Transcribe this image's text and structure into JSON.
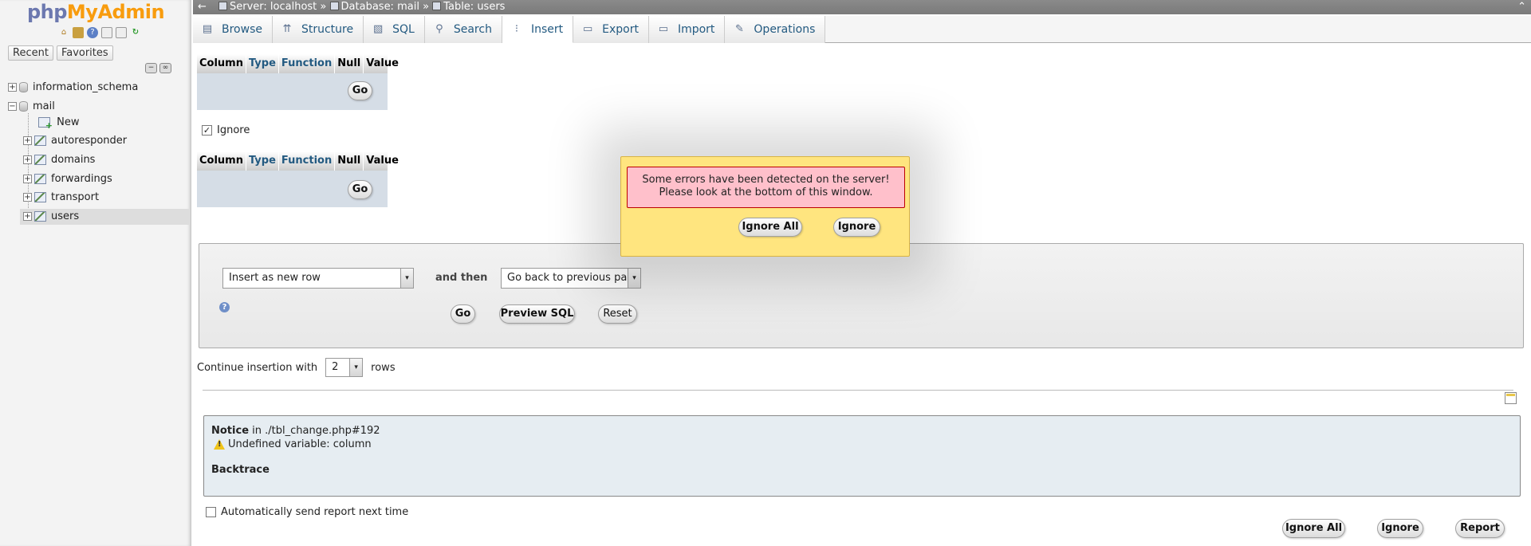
{
  "nav": {
    "logo_php": "php",
    "logo_myadmin": "MyAdmin",
    "icons": [
      "home-icon",
      "database-icon",
      "help-icon",
      "docs-icon",
      "settings-icon",
      "reload-icon"
    ],
    "tabs": [
      "Recent",
      "Favorites"
    ],
    "tree": {
      "db1": "information_schema",
      "db2": "mail",
      "new": "New",
      "tables": [
        "autoresponder",
        "domains",
        "forwardings",
        "transport",
        "users"
      ]
    }
  },
  "topbar": {
    "back": "←",
    "server": "Server: localhost",
    "database": "Database: mail",
    "table": "Table: users",
    "sep": "»",
    "up": "⌃"
  },
  "tabs": [
    {
      "label": "Browse",
      "icon": "browse-icon",
      "glyph": "▤"
    },
    {
      "label": "Structure",
      "icon": "structure-icon",
      "glyph": "⇈"
    },
    {
      "label": "SQL",
      "icon": "sql-icon",
      "glyph": "▧"
    },
    {
      "label": "Search",
      "icon": "search-icon",
      "glyph": "⚲"
    },
    {
      "label": "Insert",
      "icon": "insert-icon",
      "glyph": "⁝"
    },
    {
      "label": "Export",
      "icon": "export-icon",
      "glyph": "▭"
    },
    {
      "label": "Import",
      "icon": "import-icon",
      "glyph": "▭"
    },
    {
      "label": "Operations",
      "icon": "wrench-icon",
      "glyph": "✎"
    }
  ],
  "columns_table": {
    "headers": [
      "Column",
      "Type",
      "Function",
      "Null",
      "Value"
    ],
    "go": "Go"
  },
  "ignore_label": "Ignore",
  "ignore_checked": "✓",
  "insert_form": {
    "insert_mode": "Insert as new row",
    "and_then": "and then",
    "after_insert": "Go back to previous page",
    "go": "Go",
    "preview_sql": "Preview SQL",
    "reset": "Reset",
    "help": "?"
  },
  "continue": {
    "prefix": "Continue insertion with",
    "value": "2",
    "suffix": "rows"
  },
  "error_notice": {
    "notice_label": "Notice",
    "notice_location": " in ./tbl_change.php#192",
    "message": "Undefined variable: column",
    "backtrace": "Backtrace"
  },
  "auto_send_label": "Automatically send report next time",
  "bottom_buttons": {
    "ignore_all": "Ignore All",
    "ignore": "Ignore",
    "report": "Report"
  },
  "modal": {
    "line1": "Some errors have been detected on the server!",
    "line2": "Please look at the bottom of this window.",
    "ignore_all": "Ignore All",
    "ignore": "Ignore"
  },
  "arrow_glyph": "▾",
  "expand_glyph": "+",
  "collapse_glyph": "−"
}
